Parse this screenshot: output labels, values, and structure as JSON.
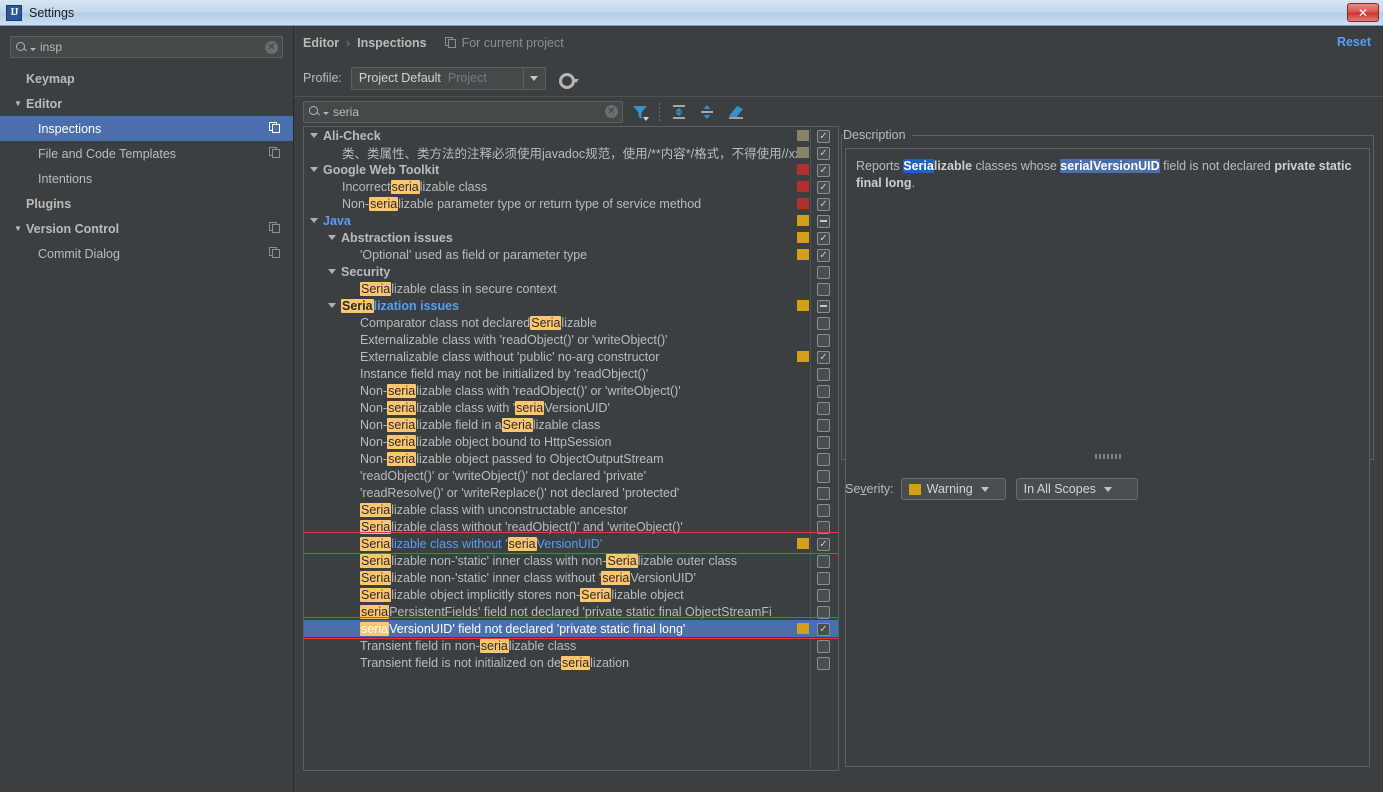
{
  "window": {
    "title": "Settings",
    "app_icon": "IJ",
    "close_label": "✕"
  },
  "sidebar": {
    "search": {
      "value": "insp",
      "clear_icon": "✕"
    },
    "items": [
      {
        "label": "Keymap",
        "level": 0,
        "bold": true,
        "arrow": "",
        "selected": false,
        "copy_icon": false
      },
      {
        "label": "Editor",
        "level": 0,
        "bold": true,
        "arrow": "▼",
        "selected": false,
        "copy_icon": false
      },
      {
        "label": "Inspections",
        "level": 1,
        "bold": false,
        "arrow": "",
        "selected": true,
        "copy_icon": true
      },
      {
        "label": "File and Code Templates",
        "level": 1,
        "bold": false,
        "arrow": "",
        "selected": false,
        "copy_icon": true
      },
      {
        "label": "Intentions",
        "level": 1,
        "bold": false,
        "arrow": "",
        "selected": false,
        "copy_icon": false
      },
      {
        "label": "Plugins",
        "level": 0,
        "bold": true,
        "arrow": "",
        "selected": false,
        "copy_icon": false
      },
      {
        "label": "Version Control",
        "level": 0,
        "bold": true,
        "arrow": "▼",
        "selected": false,
        "copy_icon": true
      },
      {
        "label": "Commit Dialog",
        "level": 1,
        "bold": false,
        "arrow": "",
        "selected": false,
        "copy_icon": true
      }
    ]
  },
  "header": {
    "breadcrumb_parent": "Editor",
    "breadcrumb_sep": "›",
    "breadcrumb_current": "Inspections",
    "for_current_project": "For current project",
    "reset_label": "Reset",
    "profile_label": "Profile:",
    "profile_value": "Project Default",
    "profile_scope": "Project"
  },
  "toolbar": {
    "search_value": "seria",
    "clear_icon": "✕",
    "icons": [
      "filter-icon",
      "expand-all-icon",
      "collapse-all-icon",
      "reset-filter-icon"
    ]
  },
  "colors": {
    "accent_blue": "#589df6",
    "selection_blue": "#4b6eaf",
    "severity_warning": "#d4a017",
    "severity_error": "#b03030",
    "severity_info": "#8a8266",
    "annotation_red": "#e8393a",
    "highlight_yellow": "#ffc66d"
  },
  "tree": {
    "rows": [
      {
        "indent": 0,
        "arrow": true,
        "bold": true,
        "blue": false,
        "selected": false,
        "sev": "#8a8266",
        "check": "check",
        "parts": [
          {
            "t": "Ali-Check",
            "h": false
          }
        ]
      },
      {
        "indent": 1,
        "arrow": false,
        "bold": false,
        "blue": false,
        "selected": false,
        "sev": "#8a8266",
        "check": "check",
        "parts": [
          {
            "t": "类、类属性、类方法的注释必须使用javadoc规范，使用/**内容*/格式，不得使用//xx",
            "h": false
          }
        ]
      },
      {
        "indent": 0,
        "arrow": true,
        "bold": true,
        "blue": false,
        "selected": false,
        "sev": "#b03030",
        "check": "check",
        "parts": [
          {
            "t": "Google Web Toolkit",
            "h": false
          }
        ]
      },
      {
        "indent": 1,
        "arrow": false,
        "bold": false,
        "blue": false,
        "selected": false,
        "sev": "#b03030",
        "check": "check",
        "parts": [
          {
            "t": "Incorrect ",
            "h": false
          },
          {
            "t": "seria",
            "h": true
          },
          {
            "t": "lizable class",
            "h": false
          }
        ]
      },
      {
        "indent": 1,
        "arrow": false,
        "bold": false,
        "blue": false,
        "selected": false,
        "sev": "#b03030",
        "check": "check",
        "parts": [
          {
            "t": "Non-",
            "h": false
          },
          {
            "t": "seria",
            "h": true
          },
          {
            "t": "lizable parameter type or return type of service method",
            "h": false
          }
        ]
      },
      {
        "indent": 0,
        "arrow": true,
        "bold": true,
        "blue": true,
        "selected": false,
        "sev": "#d4a017",
        "check": "dash",
        "parts": [
          {
            "t": "Java",
            "h": false
          }
        ]
      },
      {
        "indent": 1,
        "arrow": true,
        "bold": true,
        "blue": false,
        "selected": false,
        "sev": "#d4a017",
        "check": "check",
        "parts": [
          {
            "t": "Abstraction issues",
            "h": false
          }
        ]
      },
      {
        "indent": 2,
        "arrow": false,
        "bold": false,
        "blue": false,
        "selected": false,
        "sev": "#d4a017",
        "check": "check",
        "parts": [
          {
            "t": "'Optional' used as field or parameter type",
            "h": false
          }
        ]
      },
      {
        "indent": 1,
        "arrow": true,
        "bold": true,
        "blue": false,
        "selected": false,
        "sev": "",
        "check": "empty",
        "parts": [
          {
            "t": "Security",
            "h": false
          }
        ]
      },
      {
        "indent": 2,
        "arrow": false,
        "bold": false,
        "blue": false,
        "selected": false,
        "sev": "",
        "check": "empty",
        "parts": [
          {
            "t": "Seria",
            "h": true
          },
          {
            "t": "lizable class in secure context",
            "h": false
          }
        ]
      },
      {
        "indent": 1,
        "arrow": true,
        "bold": true,
        "blue": true,
        "selected": false,
        "sev": "#d4a017",
        "check": "dash",
        "parts": [
          {
            "t": "Seria",
            "h": true
          },
          {
            "t": "lization issues",
            "h": false
          }
        ]
      },
      {
        "indent": 2,
        "arrow": false,
        "bold": false,
        "blue": false,
        "selected": false,
        "sev": "",
        "check": "empty",
        "parts": [
          {
            "t": "Comparator class not declared ",
            "h": false
          },
          {
            "t": "Seria",
            "h": true
          },
          {
            "t": "lizable",
            "h": false
          }
        ]
      },
      {
        "indent": 2,
        "arrow": false,
        "bold": false,
        "blue": false,
        "selected": false,
        "sev": "",
        "check": "empty",
        "parts": [
          {
            "t": "Externalizable class with 'readObject()' or 'writeObject()'",
            "h": false
          }
        ]
      },
      {
        "indent": 2,
        "arrow": false,
        "bold": false,
        "blue": false,
        "selected": false,
        "sev": "#d4a017",
        "check": "check",
        "parts": [
          {
            "t": "Externalizable class without 'public' no-arg constructor",
            "h": false
          }
        ]
      },
      {
        "indent": 2,
        "arrow": false,
        "bold": false,
        "blue": false,
        "selected": false,
        "sev": "",
        "check": "empty",
        "parts": [
          {
            "t": "Instance field may not be initialized by 'readObject()'",
            "h": false
          }
        ]
      },
      {
        "indent": 2,
        "arrow": false,
        "bold": false,
        "blue": false,
        "selected": false,
        "sev": "",
        "check": "empty",
        "parts": [
          {
            "t": "Non-",
            "h": false
          },
          {
            "t": "seria",
            "h": true
          },
          {
            "t": "lizable class with 'readObject()' or 'writeObject()'",
            "h": false
          }
        ]
      },
      {
        "indent": 2,
        "arrow": false,
        "bold": false,
        "blue": false,
        "selected": false,
        "sev": "",
        "check": "empty",
        "parts": [
          {
            "t": "Non-",
            "h": false
          },
          {
            "t": "seria",
            "h": true
          },
          {
            "t": "lizable class with '",
            "h": false
          },
          {
            "t": "seria",
            "h": true
          },
          {
            "t": "VersionUID'",
            "h": false
          }
        ]
      },
      {
        "indent": 2,
        "arrow": false,
        "bold": false,
        "blue": false,
        "selected": false,
        "sev": "",
        "check": "empty",
        "parts": [
          {
            "t": "Non-",
            "h": false
          },
          {
            "t": "seria",
            "h": true
          },
          {
            "t": "lizable field in a ",
            "h": false
          },
          {
            "t": "Seria",
            "h": true
          },
          {
            "t": "lizable class",
            "h": false
          }
        ]
      },
      {
        "indent": 2,
        "arrow": false,
        "bold": false,
        "blue": false,
        "selected": false,
        "sev": "",
        "check": "empty",
        "parts": [
          {
            "t": "Non-",
            "h": false
          },
          {
            "t": "seria",
            "h": true
          },
          {
            "t": "lizable object bound to HttpSession",
            "h": false
          }
        ]
      },
      {
        "indent": 2,
        "arrow": false,
        "bold": false,
        "blue": false,
        "selected": false,
        "sev": "",
        "check": "empty",
        "parts": [
          {
            "t": "Non-",
            "h": false
          },
          {
            "t": "seria",
            "h": true
          },
          {
            "t": "lizable object passed to ObjectOutputStream",
            "h": false
          }
        ]
      },
      {
        "indent": 2,
        "arrow": false,
        "bold": false,
        "blue": false,
        "selected": false,
        "sev": "",
        "check": "empty",
        "parts": [
          {
            "t": "'readObject()' or 'writeObject()' not declared 'private'",
            "h": false
          }
        ]
      },
      {
        "indent": 2,
        "arrow": false,
        "bold": false,
        "blue": false,
        "selected": false,
        "sev": "",
        "check": "empty",
        "parts": [
          {
            "t": "'readResolve()' or 'writeReplace()' not declared 'protected'",
            "h": false
          }
        ]
      },
      {
        "indent": 2,
        "arrow": false,
        "bold": false,
        "blue": false,
        "selected": false,
        "sev": "",
        "check": "empty",
        "parts": [
          {
            "t": "Seria",
            "h": true
          },
          {
            "t": "lizable class with unconstructable ancestor",
            "h": false
          }
        ]
      },
      {
        "indent": 2,
        "arrow": false,
        "bold": false,
        "blue": false,
        "selected": false,
        "sev": "",
        "check": "empty",
        "parts": [
          {
            "t": "Seria",
            "h": true
          },
          {
            "t": "lizable class without 'readObject()' and 'writeObject()'",
            "h": false
          }
        ]
      },
      {
        "indent": 2,
        "arrow": false,
        "bold": false,
        "blue": true,
        "selected": false,
        "sev": "#d4a017",
        "check": "check",
        "parts": [
          {
            "t": "Seria",
            "h": true
          },
          {
            "t": "lizable class without '",
            "h": false
          },
          {
            "t": "seria",
            "h": true
          },
          {
            "t": "VersionUID'",
            "h": false
          }
        ]
      },
      {
        "indent": 2,
        "arrow": false,
        "bold": false,
        "blue": false,
        "selected": false,
        "sev": "",
        "check": "empty",
        "parts": [
          {
            "t": "Seria",
            "h": true
          },
          {
            "t": "lizable non-'static' inner class with non-",
            "h": false
          },
          {
            "t": "Seria",
            "h": true
          },
          {
            "t": "lizable outer class",
            "h": false
          }
        ]
      },
      {
        "indent": 2,
        "arrow": false,
        "bold": false,
        "blue": false,
        "selected": false,
        "sev": "",
        "check": "empty",
        "parts": [
          {
            "t": "Seria",
            "h": true
          },
          {
            "t": "lizable non-'static' inner class without '",
            "h": false
          },
          {
            "t": "seria",
            "h": true
          },
          {
            "t": "VersionUID'",
            "h": false
          }
        ]
      },
      {
        "indent": 2,
        "arrow": false,
        "bold": false,
        "blue": false,
        "selected": false,
        "sev": "",
        "check": "empty",
        "parts": [
          {
            "t": "Seria",
            "h": true
          },
          {
            "t": "lizable object implicitly stores non-",
            "h": false
          },
          {
            "t": "Seria",
            "h": true
          },
          {
            "t": "lizable object",
            "h": false
          }
        ]
      },
      {
        "indent": 2,
        "arrow": false,
        "bold": false,
        "blue": false,
        "selected": false,
        "sev": "",
        "check": "empty",
        "parts": [
          {
            "t": "seria",
            "h": true
          },
          {
            "t": "PersistentFields' field not declared 'private static final ObjectStreamFi",
            "h": false
          }
        ]
      },
      {
        "indent": 2,
        "arrow": false,
        "bold": false,
        "blue": false,
        "selected": true,
        "sev": "#d4a017",
        "check": "check",
        "parts": [
          {
            "t": "seria",
            "h": true
          },
          {
            "t": "VersionUID' field not declared 'private static final long'",
            "h": false
          }
        ]
      },
      {
        "indent": 2,
        "arrow": false,
        "bold": false,
        "blue": false,
        "selected": false,
        "sev": "",
        "check": "empty",
        "parts": [
          {
            "t": "Transient field in non-",
            "h": false
          },
          {
            "t": "seria",
            "h": true
          },
          {
            "t": "lizable class",
            "h": false
          }
        ]
      },
      {
        "indent": 2,
        "arrow": false,
        "bold": false,
        "blue": false,
        "selected": false,
        "sev": "",
        "check": "empty",
        "parts": [
          {
            "t": "Transient field is not initialized on de",
            "h": false
          },
          {
            "t": "seria",
            "h": true
          },
          {
            "t": "lization",
            "h": false
          }
        ]
      }
    ],
    "annotations": [
      {
        "row_index": 24,
        "label": "annotation-box-serializable-without-uid"
      },
      {
        "row_index": 29,
        "label": "annotation-box-serialversionuid-field"
      }
    ]
  },
  "description": {
    "title": "Description",
    "segments": [
      {
        "t": "Reports ",
        "style": "normal"
      },
      {
        "t": "Seria",
        "style": "match"
      },
      {
        "t": "lizable",
        "style": "bold"
      },
      {
        "t": " classes whose ",
        "style": "normal"
      },
      {
        "t": "serialVersionUID",
        "style": "match2"
      },
      {
        "t": " field is not declared ",
        "style": "normal"
      },
      {
        "t": "private static final long",
        "style": "bold"
      },
      {
        "t": ".",
        "style": "normal"
      }
    ]
  },
  "severity": {
    "label": "Severity:",
    "value": "Warning",
    "swatch": "#d4a017",
    "scope_value": "In All Scopes"
  }
}
